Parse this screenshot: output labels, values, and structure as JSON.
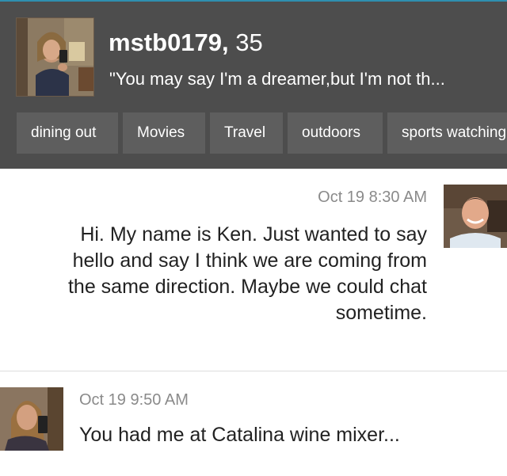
{
  "profile": {
    "username": "mstb0179,",
    "age": "35",
    "tagline": "\"You may say I'm a dreamer,but I'm not th...",
    "photo_icon": "profile-photo-woman-selfie"
  },
  "interests": [
    "dining out",
    "Movies",
    "Travel",
    "outdoors",
    "sports watching"
  ],
  "messages": [
    {
      "timestamp": "Oct 19 8:30 AM",
      "text": "Hi. My name is Ken. Just wanted to say hello and say I think we are coming from the same direction. Maybe we could chat sometime.",
      "avatar": "avatar-man"
    },
    {
      "timestamp": "Oct 19 9:50 AM",
      "text": "You had me at Catalina wine mixer...",
      "avatar": "avatar-woman"
    }
  ]
}
